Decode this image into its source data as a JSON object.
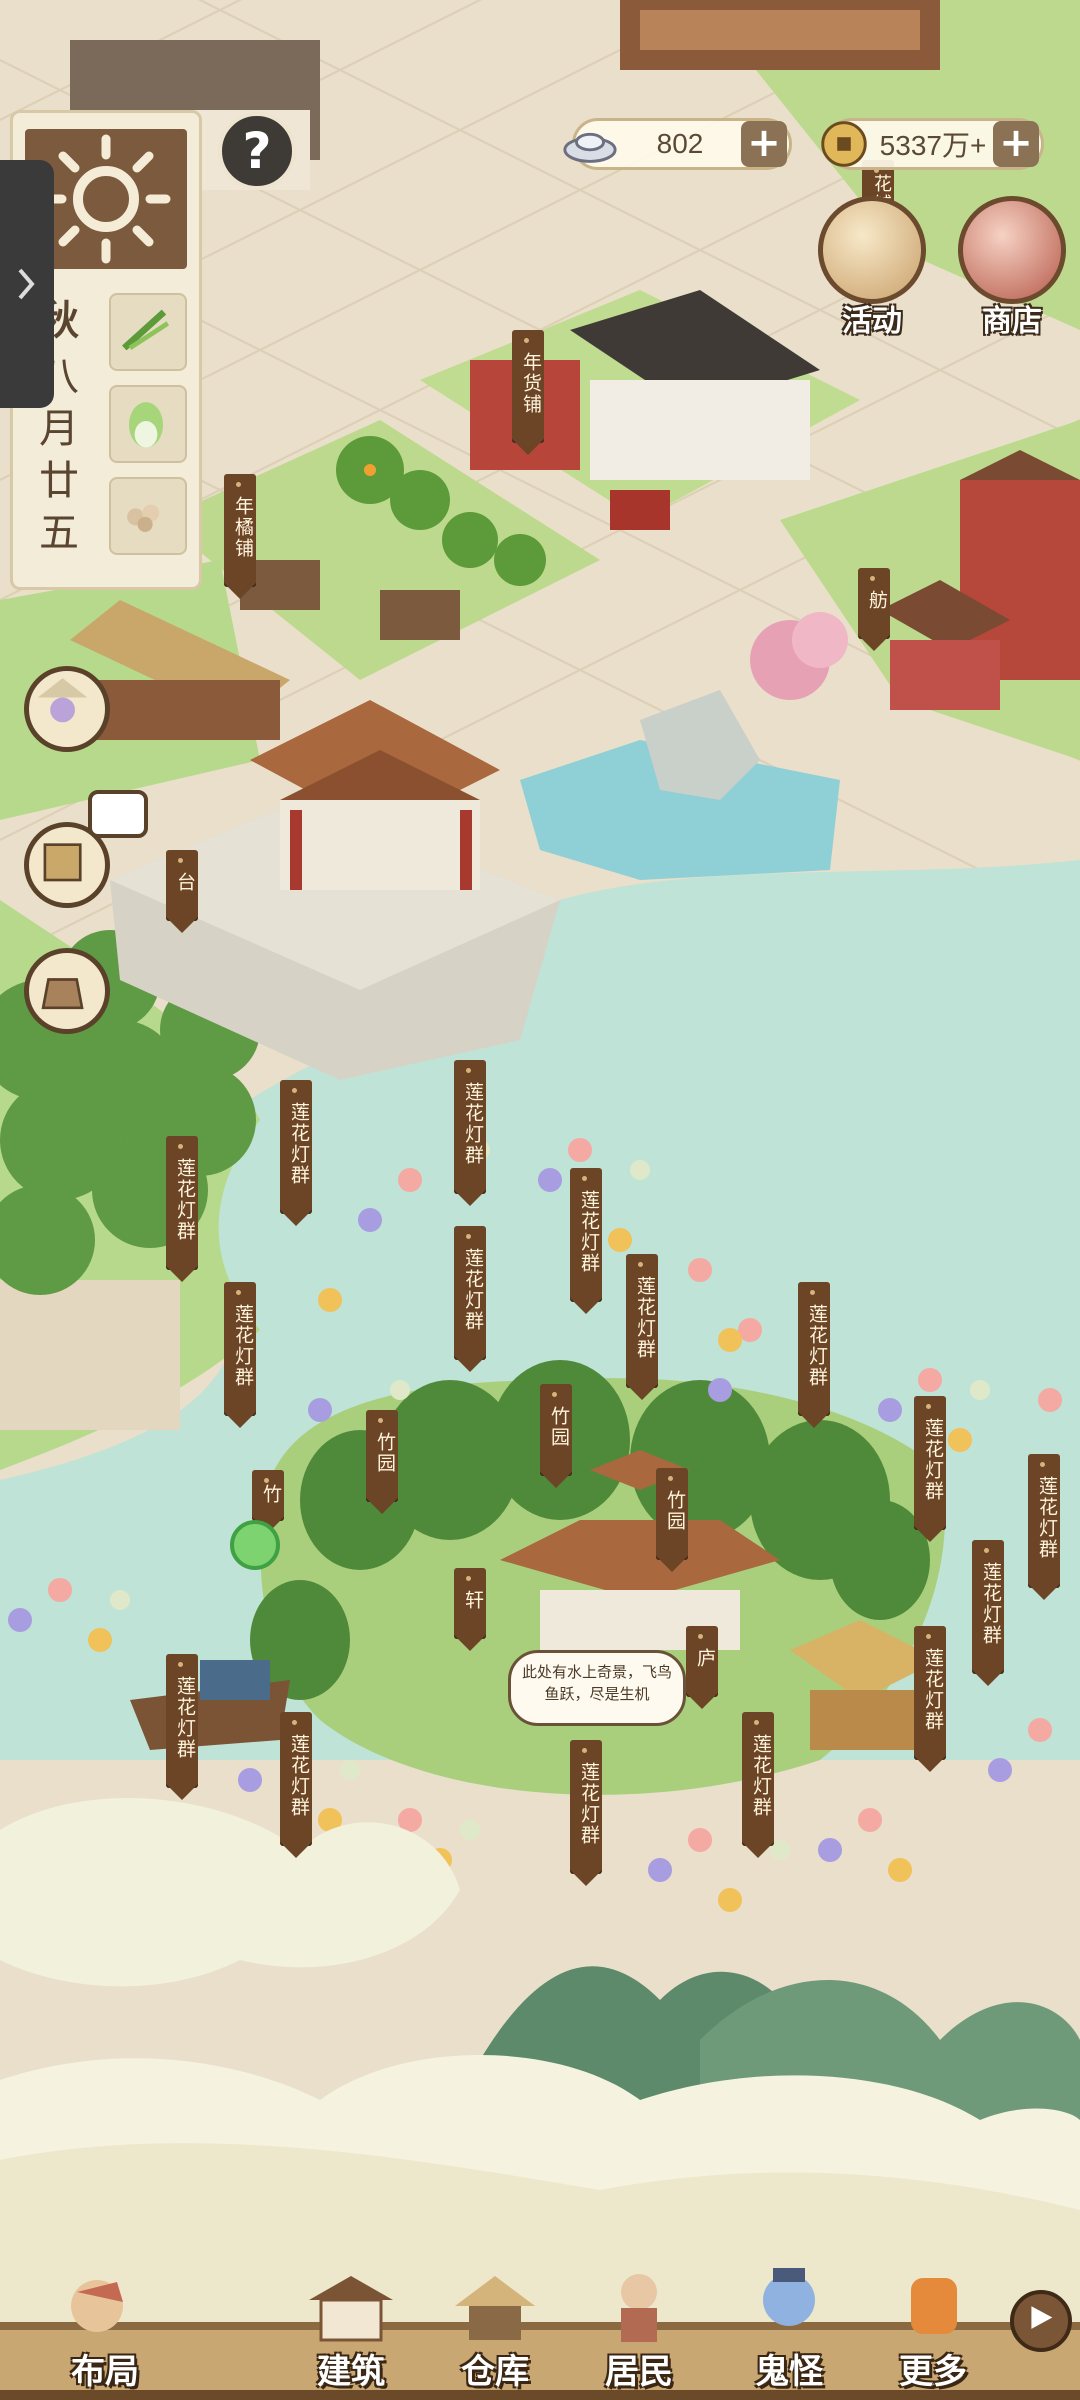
{
  "currency": {
    "silver": "802",
    "copper": "5337万+"
  },
  "top_buttons": {
    "activity": "活动",
    "shop": "商店"
  },
  "season": {
    "name": "秋",
    "month": "八",
    "day_line1": "月",
    "day_line2": "廿",
    "day_line3": "五"
  },
  "signs": {
    "nianhuopu": "年货铺",
    "nianjupu": "年橘铺",
    "fang": "舫",
    "tai": "台",
    "lotus": "莲花灯群",
    "zhuyuan": "竹园",
    "xuan": "轩",
    "lu": "庐",
    "zhu_partial": "竹",
    "huapu_partial": "花铺"
  },
  "bubble_text": "此处有水上奇景，飞鸟鱼跃，尽是生机",
  "bottom_nav": {
    "layout": "布局",
    "build": "建筑",
    "storage": "仓库",
    "residents": "居民",
    "ghosts": "鬼怪",
    "more": "更多"
  },
  "colors": {
    "water": "#bfe3d6",
    "grass": "#b7d98c",
    "paving": "#e9dfca",
    "sign_wood": "#6b4526",
    "frame": "#5a412a"
  }
}
